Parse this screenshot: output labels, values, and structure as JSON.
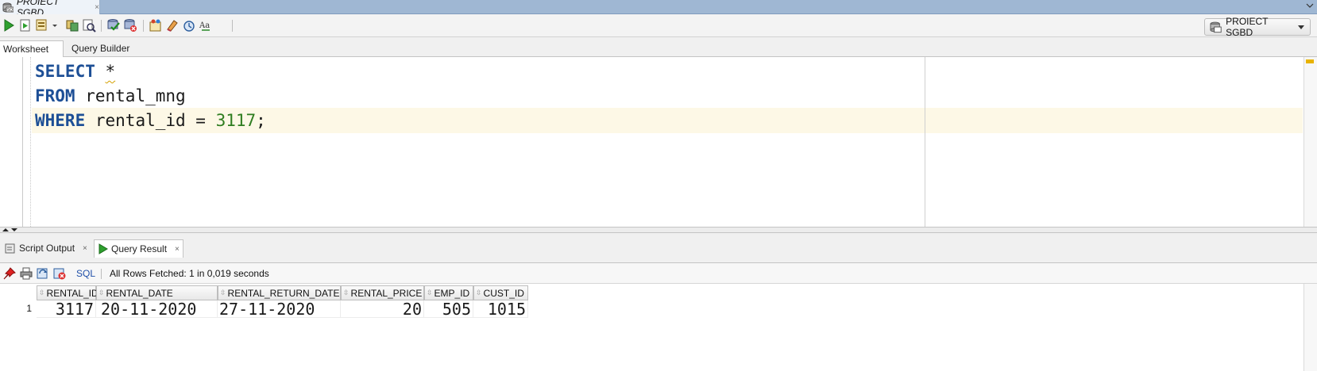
{
  "window": {
    "tab_title": "PROIECT SGBD",
    "tab_close": "×"
  },
  "toolbar": {
    "connection_label": "PROIECT SGBD",
    "buttons": [
      "run-statement-icon",
      "run-script-icon",
      "autotrace-icon",
      "explain-plan-icon",
      "sql-tuning-icon",
      "commit-icon",
      "rollback-icon",
      "unshared-sql-icon",
      "clear-icon",
      "sql-history-icon",
      "format-icon"
    ]
  },
  "subtabs": {
    "worksheet": "Worksheet",
    "query_builder": "Query Builder"
  },
  "editor": {
    "line1_kw": "SELECT",
    "line1_rest": "*",
    "line2_kw": "FROM",
    "line2_rest": "rental_mng",
    "line3_kw": "WHERE",
    "line3_mid": "rental_id = ",
    "line3_num": "3117",
    "line3_end": ";"
  },
  "results": {
    "tabs": [
      {
        "label": "Script Output",
        "close": "×"
      },
      {
        "label": "Query Result",
        "close": "×"
      }
    ],
    "sql_link": "SQL",
    "status": "All Rows Fetched: 1 in 0,019 seconds",
    "columns": [
      "RENTAL_ID",
      "RENTAL_DATE",
      "RENTAL_RETURN_DATE",
      "RENTAL_PRICE",
      "EMP_ID",
      "CUST_ID"
    ],
    "rows": [
      {
        "num": "1",
        "cells": [
          "3117",
          "20-11-2020",
          "27-11-2020",
          "20",
          "505",
          "1015"
        ]
      }
    ]
  },
  "colors": {
    "keyword": "#1d4f96",
    "number": "#2f7d20",
    "current_line": "#fdf8e6",
    "titlebar": "#9fb7d3"
  }
}
